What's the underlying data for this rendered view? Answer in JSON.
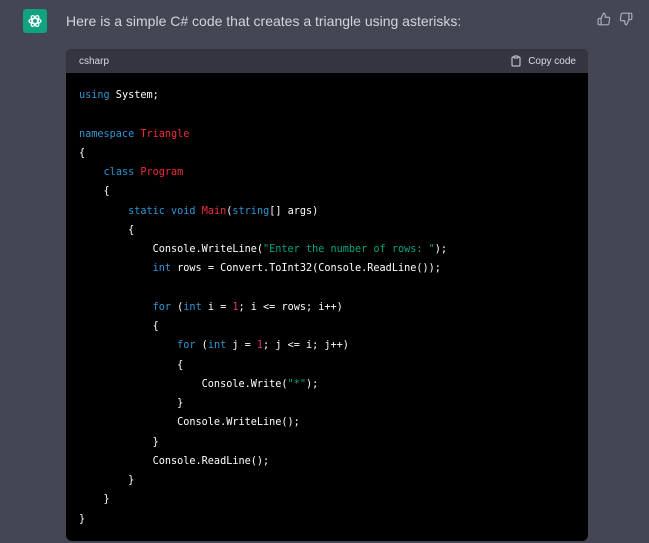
{
  "message": {
    "text": "Here is a simple C# code that creates a triangle using asterisks:"
  },
  "code_block": {
    "language": "csharp",
    "copy_label": "Copy code",
    "lines": [
      [
        {
          "t": "using",
          "c": "kw"
        },
        {
          "t": " System;"
        }
      ],
      [],
      [
        {
          "t": "namespace",
          "c": "kw"
        },
        {
          "t": " "
        },
        {
          "t": "Triangle",
          "c": "ty"
        }
      ],
      [
        {
          "t": "{"
        }
      ],
      [
        {
          "t": "    "
        },
        {
          "t": "class",
          "c": "kw"
        },
        {
          "t": " "
        },
        {
          "t": "Program",
          "c": "ty"
        }
      ],
      [
        {
          "t": "    {"
        }
      ],
      [
        {
          "t": "        "
        },
        {
          "t": "static",
          "c": "kw"
        },
        {
          "t": " "
        },
        {
          "t": "void",
          "c": "kw"
        },
        {
          "t": " "
        },
        {
          "t": "Main",
          "c": "ty"
        },
        {
          "t": "("
        },
        {
          "t": "string",
          "c": "kw"
        },
        {
          "t": "[] args)"
        }
      ],
      [
        {
          "t": "        {"
        }
      ],
      [
        {
          "t": "            Console.WriteLine("
        },
        {
          "t": "\"Enter the number of rows: \"",
          "c": "st"
        },
        {
          "t": ");"
        }
      ],
      [
        {
          "t": "            "
        },
        {
          "t": "int",
          "c": "kw"
        },
        {
          "t": " rows = Convert.ToInt32(Console.ReadLine());"
        }
      ],
      [],
      [
        {
          "t": "            "
        },
        {
          "t": "for",
          "c": "kw"
        },
        {
          "t": " ("
        },
        {
          "t": "int",
          "c": "kw"
        },
        {
          "t": " i = "
        },
        {
          "t": "1",
          "c": "nm"
        },
        {
          "t": "; i <= rows; i++)"
        }
      ],
      [
        {
          "t": "            {"
        }
      ],
      [
        {
          "t": "                "
        },
        {
          "t": "for",
          "c": "kw"
        },
        {
          "t": " ("
        },
        {
          "t": "int",
          "c": "kw"
        },
        {
          "t": " j = "
        },
        {
          "t": "1",
          "c": "nm"
        },
        {
          "t": "; j <= i; j++)"
        }
      ],
      [
        {
          "t": "                {"
        }
      ],
      [
        {
          "t": "                    Console.Write("
        },
        {
          "t": "\"*\"",
          "c": "st"
        },
        {
          "t": ");"
        }
      ],
      [
        {
          "t": "                }"
        }
      ],
      [
        {
          "t": "                Console.WriteLine();"
        }
      ],
      [
        {
          "t": "            }"
        }
      ],
      [
        {
          "t": "            Console.ReadLine();"
        }
      ],
      [
        {
          "t": "        }"
        }
      ],
      [
        {
          "t": "    }"
        }
      ],
      [
        {
          "t": "}"
        }
      ]
    ]
  },
  "icons": {
    "avatar": "openai-logo-icon",
    "thumbs_up": "thumbs-up-icon",
    "thumbs_down": "thumbs-down-icon",
    "copy": "clipboard-icon"
  },
  "colors": {
    "background": "#444654",
    "avatar": "#10a37f",
    "keyword": "#2e95d3",
    "type": "#f22c3d",
    "string": "#00a67d",
    "number": "#df3079"
  }
}
